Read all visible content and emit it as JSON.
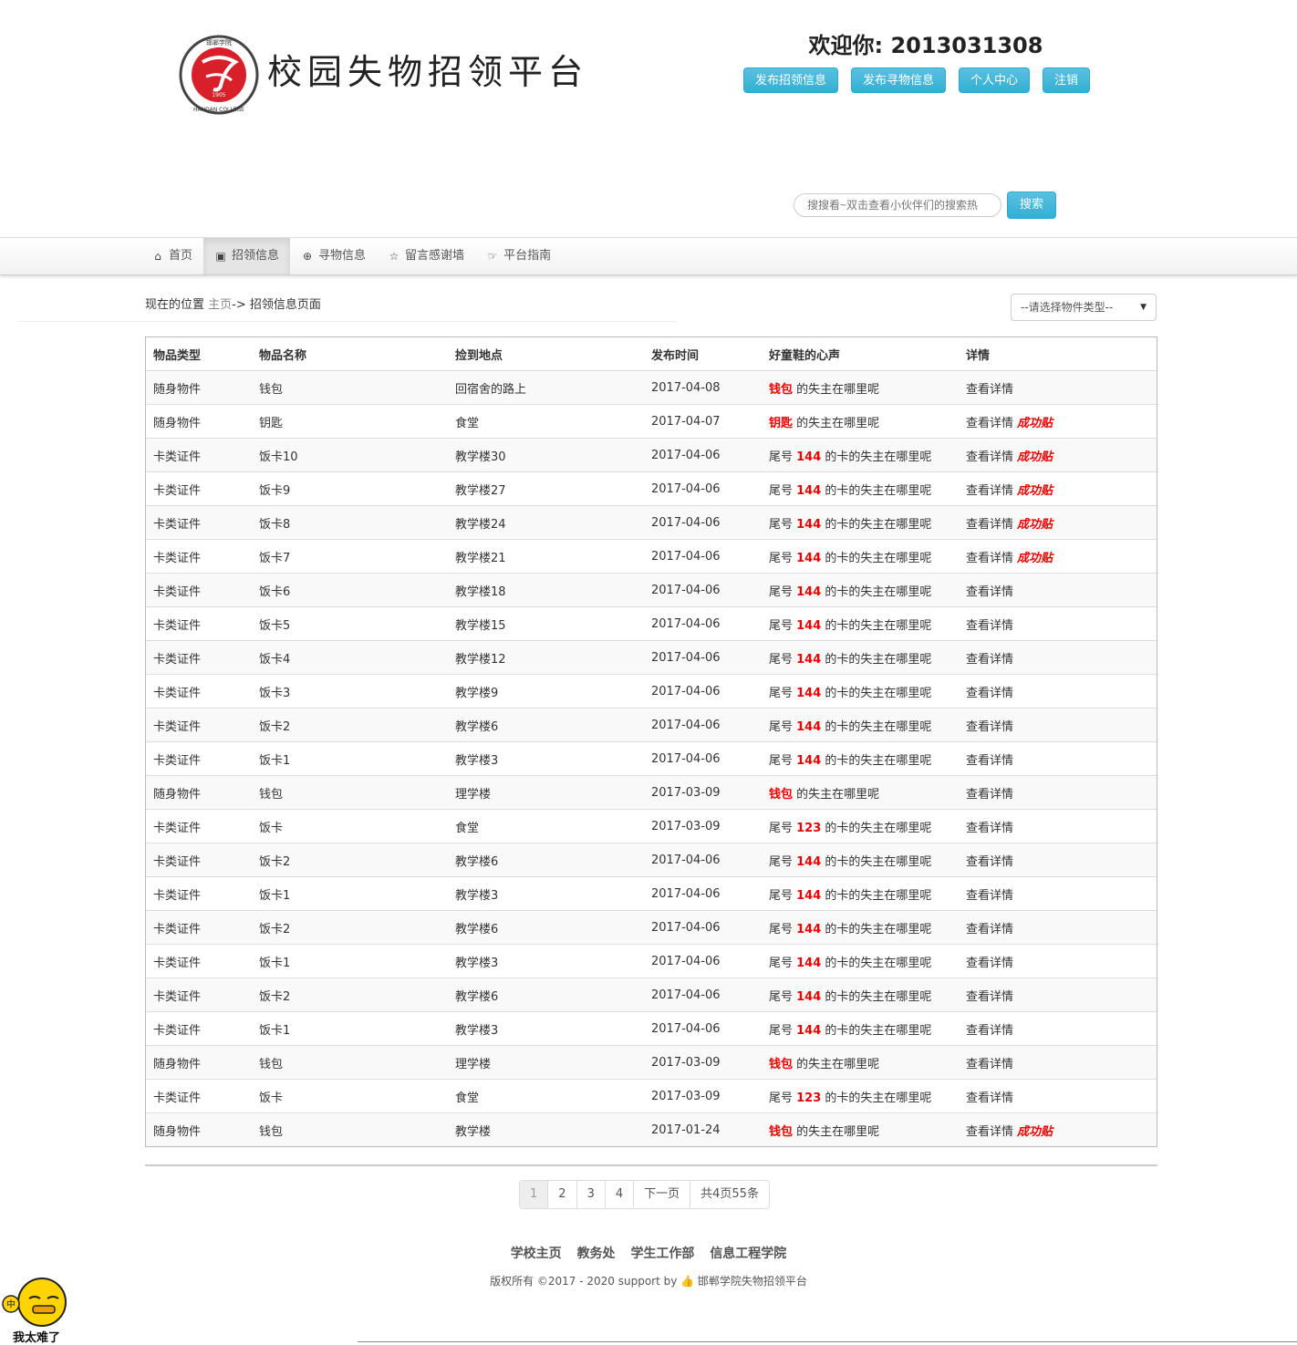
{
  "header": {
    "site_title": "校园失物招领平台",
    "logo_text_top": "邯郸学院",
    "logo_text_bottom": "HANDAN COLLEGE",
    "logo_year": "1905",
    "welcome": "欢迎你: 2013031308",
    "buttons": [
      "发布招领信息",
      "发布寻物信息",
      "个人中心",
      "注销"
    ]
  },
  "search": {
    "placeholder": "搜搜看~双击查看小伙伴们的搜索热",
    "button_label": "搜索"
  },
  "nav": [
    {
      "label": "首页",
      "icon": "home-icon",
      "glyph": "⌂"
    },
    {
      "label": "招领信息",
      "icon": "picture-icon",
      "glyph": "▣"
    },
    {
      "label": "寻物信息",
      "icon": "zoom-in-icon",
      "glyph": "⊕"
    },
    {
      "label": "留言感谢墙",
      "icon": "star-icon",
      "glyph": "☆"
    },
    {
      "label": "平台指南",
      "icon": "hand-right-icon",
      "glyph": "☞"
    }
  ],
  "breadcrumb": {
    "prefix": "现在的位置 ",
    "home": "主页",
    "rest": "-> 招领信息页面"
  },
  "filter": {
    "selected": "--请选择物件类型--"
  },
  "table": {
    "headers": [
      "物品类型",
      "物品名称",
      "捡到地点",
      "发布时间",
      "好童鞋的心声",
      "详情"
    ],
    "detail_label": "查看详情",
    "success_label": "成功贴",
    "rows": [
      {
        "type": "随身物件",
        "name": "钱包",
        "place": "回宿舍的路上",
        "date": "2017-04-08",
        "pre": "",
        "hl": "钱包",
        "post": " 的失主在哪里呢",
        "success": false
      },
      {
        "type": "随身物件",
        "name": "钥匙",
        "place": "食堂",
        "date": "2017-04-07",
        "pre": "",
        "hl": "钥匙",
        "post": " 的失主在哪里呢",
        "success": true
      },
      {
        "type": "卡类证件",
        "name": "饭卡10",
        "place": "教学楼30",
        "date": "2017-04-06",
        "pre": "尾号 ",
        "hl": "144",
        "post": " 的卡的失主在哪里呢",
        "success": true
      },
      {
        "type": "卡类证件",
        "name": "饭卡9",
        "place": "教学楼27",
        "date": "2017-04-06",
        "pre": "尾号 ",
        "hl": "144",
        "post": " 的卡的失主在哪里呢",
        "success": true
      },
      {
        "type": "卡类证件",
        "name": "饭卡8",
        "place": "教学楼24",
        "date": "2017-04-06",
        "pre": "尾号 ",
        "hl": "144",
        "post": " 的卡的失主在哪里呢",
        "success": true
      },
      {
        "type": "卡类证件",
        "name": "饭卡7",
        "place": "教学楼21",
        "date": "2017-04-06",
        "pre": "尾号 ",
        "hl": "144",
        "post": " 的卡的失主在哪里呢",
        "success": true
      },
      {
        "type": "卡类证件",
        "name": "饭卡6",
        "place": "教学楼18",
        "date": "2017-04-06",
        "pre": "尾号 ",
        "hl": "144",
        "post": " 的卡的失主在哪里呢",
        "success": false
      },
      {
        "type": "卡类证件",
        "name": "饭卡5",
        "place": "教学楼15",
        "date": "2017-04-06",
        "pre": "尾号 ",
        "hl": "144",
        "post": " 的卡的失主在哪里呢",
        "success": false
      },
      {
        "type": "卡类证件",
        "name": "饭卡4",
        "place": "教学楼12",
        "date": "2017-04-06",
        "pre": "尾号 ",
        "hl": "144",
        "post": " 的卡的失主在哪里呢",
        "success": false
      },
      {
        "type": "卡类证件",
        "name": "饭卡3",
        "place": "教学楼9",
        "date": "2017-04-06",
        "pre": "尾号 ",
        "hl": "144",
        "post": " 的卡的失主在哪里呢",
        "success": false
      },
      {
        "type": "卡类证件",
        "name": "饭卡2",
        "place": "教学楼6",
        "date": "2017-04-06",
        "pre": "尾号 ",
        "hl": "144",
        "post": " 的卡的失主在哪里呢",
        "success": false
      },
      {
        "type": "卡类证件",
        "name": "饭卡1",
        "place": "教学楼3",
        "date": "2017-04-06",
        "pre": "尾号 ",
        "hl": "144",
        "post": " 的卡的失主在哪里呢",
        "success": false
      },
      {
        "type": "随身物件",
        "name": "钱包",
        "place": "理学楼",
        "date": "2017-03-09",
        "pre": "",
        "hl": "钱包",
        "post": " 的失主在哪里呢",
        "success": false
      },
      {
        "type": "卡类证件",
        "name": "饭卡",
        "place": "食堂",
        "date": "2017-03-09",
        "pre": "尾号 ",
        "hl": "123",
        "post": " 的卡的失主在哪里呢",
        "success": false
      },
      {
        "type": "卡类证件",
        "name": "饭卡2",
        "place": "教学楼6",
        "date": "2017-04-06",
        "pre": "尾号 ",
        "hl": "144",
        "post": " 的卡的失主在哪里呢",
        "success": false
      },
      {
        "type": "卡类证件",
        "name": "饭卡1",
        "place": "教学楼3",
        "date": "2017-04-06",
        "pre": "尾号 ",
        "hl": "144",
        "post": " 的卡的失主在哪里呢",
        "success": false
      },
      {
        "type": "卡类证件",
        "name": "饭卡2",
        "place": "教学楼6",
        "date": "2017-04-06",
        "pre": "尾号 ",
        "hl": "144",
        "post": " 的卡的失主在哪里呢",
        "success": false
      },
      {
        "type": "卡类证件",
        "name": "饭卡1",
        "place": "教学楼3",
        "date": "2017-04-06",
        "pre": "尾号 ",
        "hl": "144",
        "post": " 的卡的失主在哪里呢",
        "success": false
      },
      {
        "type": "卡类证件",
        "name": "饭卡2",
        "place": "教学楼6",
        "date": "2017-04-06",
        "pre": "尾号 ",
        "hl": "144",
        "post": " 的卡的失主在哪里呢",
        "success": false
      },
      {
        "type": "卡类证件",
        "name": "饭卡1",
        "place": "教学楼3",
        "date": "2017-04-06",
        "pre": "尾号 ",
        "hl": "144",
        "post": " 的卡的失主在哪里呢",
        "success": false
      },
      {
        "type": "随身物件",
        "name": "钱包",
        "place": "理学楼",
        "date": "2017-03-09",
        "pre": "",
        "hl": "钱包",
        "post": " 的失主在哪里呢",
        "success": false
      },
      {
        "type": "卡类证件",
        "name": "饭卡",
        "place": "食堂",
        "date": "2017-03-09",
        "pre": "尾号 ",
        "hl": "123",
        "post": " 的卡的失主在哪里呢",
        "success": false
      },
      {
        "type": "随身物件",
        "name": "钱包",
        "place": "教学楼",
        "date": "2017-01-24",
        "pre": "",
        "hl": "钱包",
        "post": " 的失主在哪里呢",
        "success": true
      }
    ]
  },
  "pagination": {
    "pages": [
      "1",
      "2",
      "3",
      "4"
    ],
    "current": "1",
    "next": "下一页",
    "info": "共4页55条"
  },
  "footer": {
    "links": [
      "学校主页",
      "教务处",
      "学生工作部",
      "信息工程学院"
    ],
    "copyright_prefix": "版权所有 ©2017 - 2020 support by ",
    "copyright_suffix": " 邯郸学院失物招领平台"
  },
  "mascot": {
    "badge": "中",
    "text": "我太难了"
  },
  "colors": {
    "accent": "#5bc0de",
    "highlight": "#ee0000"
  }
}
